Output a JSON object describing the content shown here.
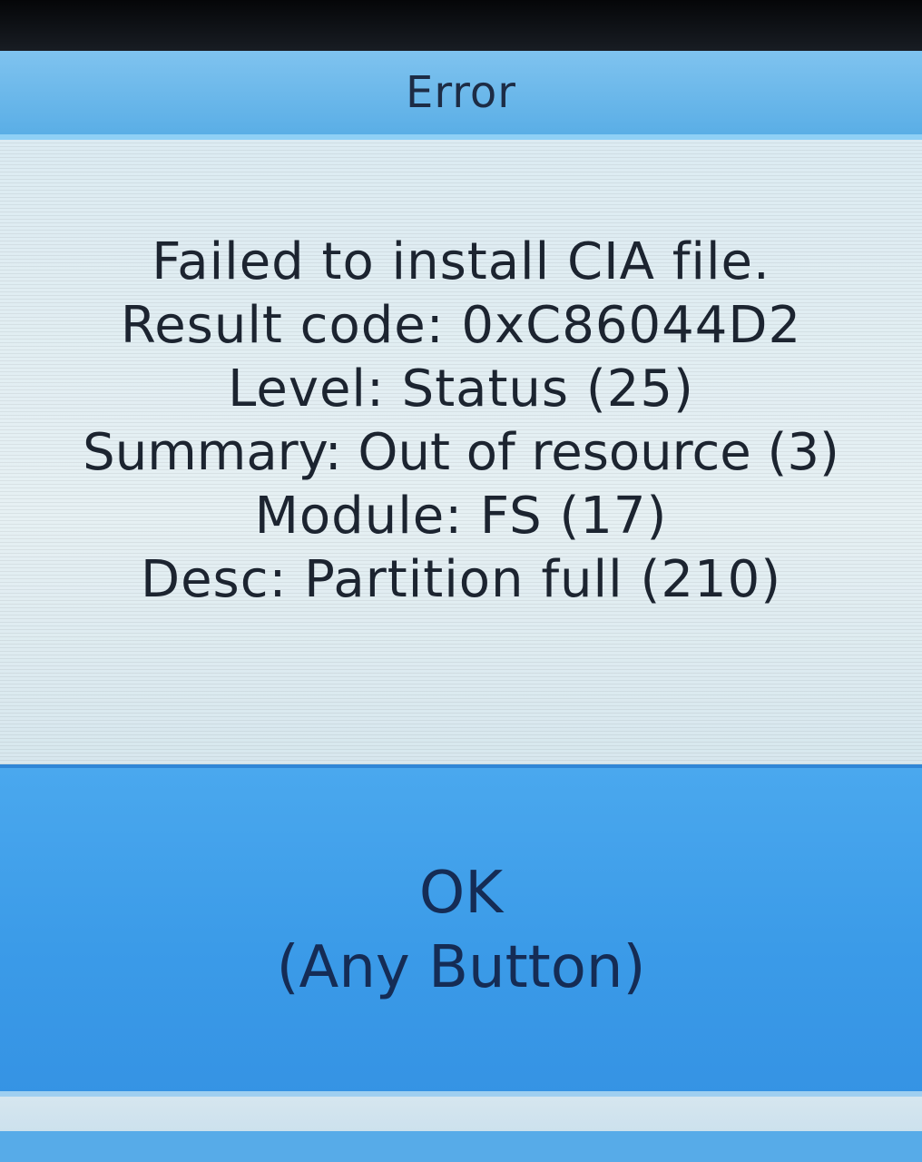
{
  "dialog": {
    "title": "Error",
    "message_lines": [
      "Failed to install CIA file.",
      "Result code: 0xC86044D2",
      "Level: Status (25)",
      "Summary: Out of resource (3)",
      "Module: FS (17)",
      "Desc: Partition full (210)"
    ],
    "button": {
      "label": "OK",
      "sublabel": "(Any Button)"
    }
  },
  "colors": {
    "title_bar": "#5aaee6",
    "message_bg": "#e1edf2",
    "button_bg": "#3b9be8",
    "text": "#1c2430"
  }
}
